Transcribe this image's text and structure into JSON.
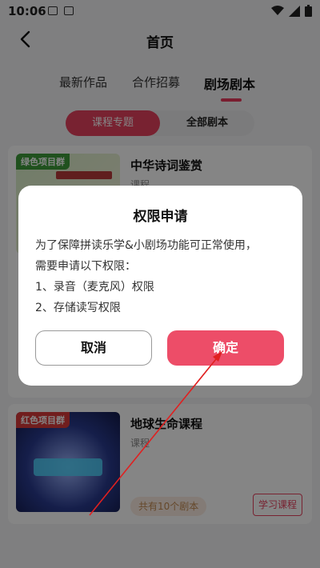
{
  "status_bar": {
    "time": "10:06"
  },
  "header": {
    "title": "首页"
  },
  "tabs": [
    {
      "label": "最新作品"
    },
    {
      "label": "合作招募"
    },
    {
      "label": "剧场剧本"
    }
  ],
  "segment": {
    "active": "课程专题",
    "inactive": "全部剧本"
  },
  "courses": [
    {
      "tag": "绿色项目群",
      "title": "中华诗词鉴赏",
      "subtitle": "课程"
    },
    {
      "tag": "红色项目群",
      "title": "地球生命课程",
      "subtitle": "课程",
      "count_label": "共有10个剧本",
      "action_label": "学习课程"
    }
  ],
  "dialog": {
    "title": "权限申请",
    "lines": [
      "为了保障拼读乐学&小剧场功能可正常使用，",
      "需要申请以下权限：",
      "1、录音（麦克风）权限",
      "2、存储读写权限"
    ],
    "cancel_label": "取消",
    "confirm_label": "确定"
  },
  "colors": {
    "accent": "#e7415f",
    "confirm": "#ed4d68"
  }
}
